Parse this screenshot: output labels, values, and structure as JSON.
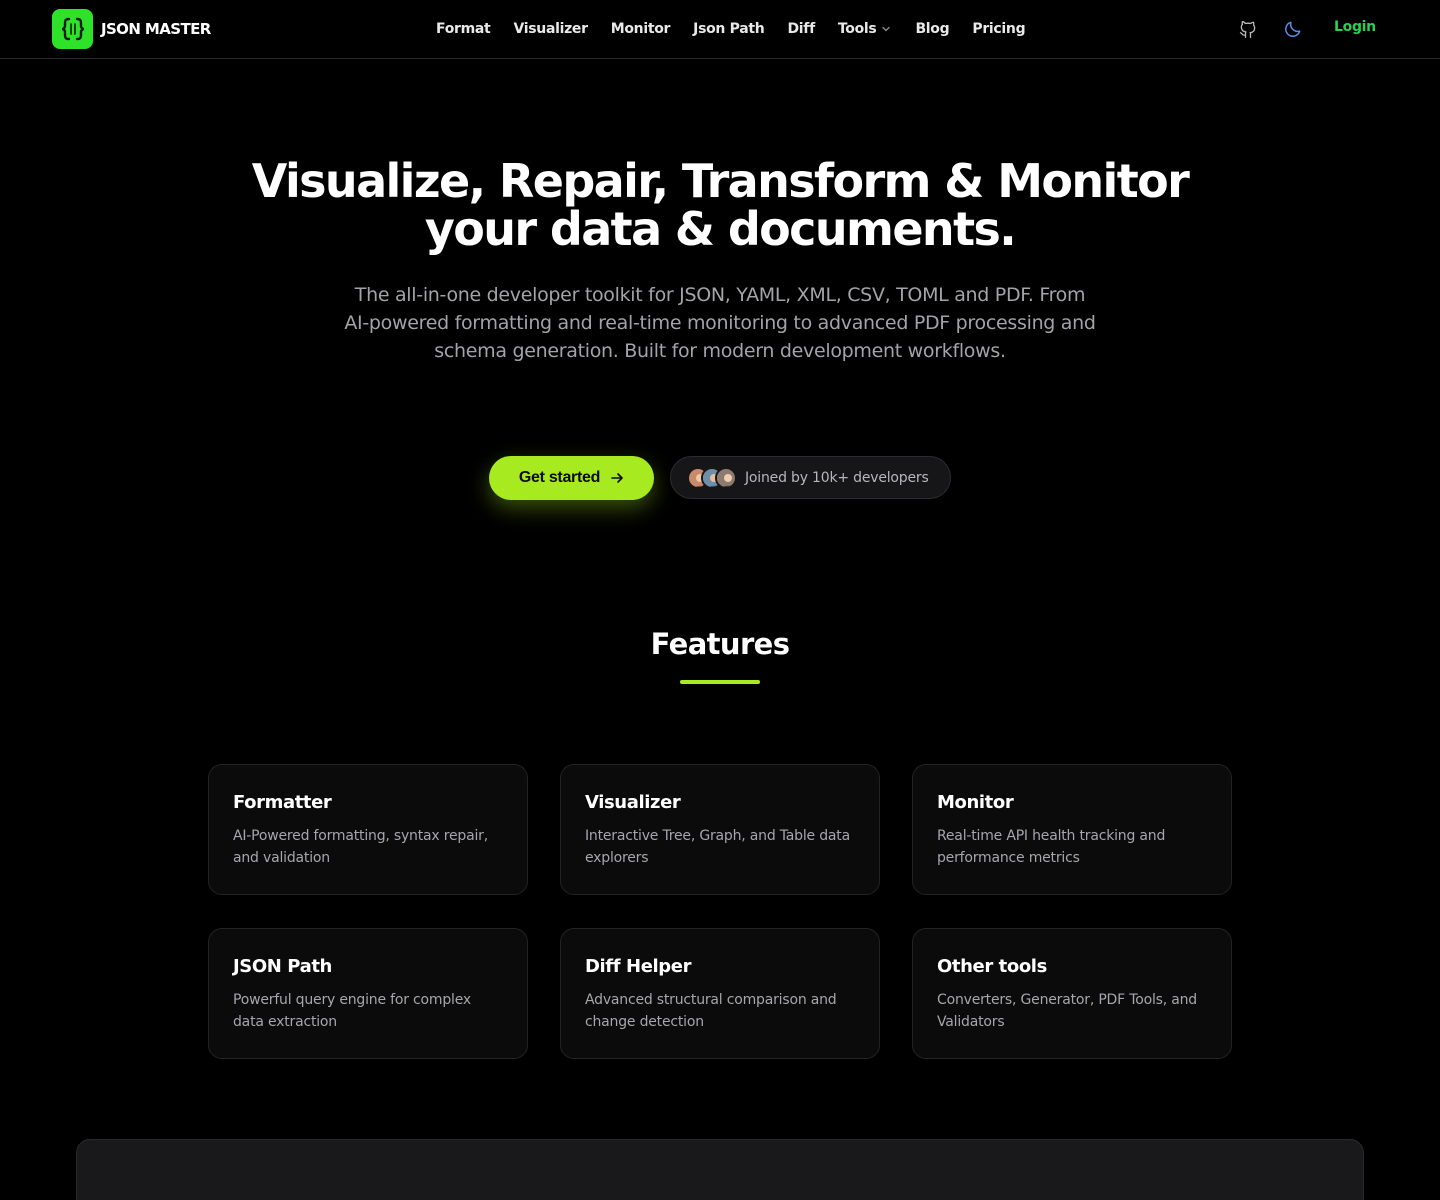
{
  "header": {
    "brand": "JSON MASTER",
    "nav": [
      "Format",
      "Visualizer",
      "Monitor",
      "Json Path",
      "Diff",
      "Tools",
      "Blog",
      "Pricing"
    ],
    "login": "Login"
  },
  "hero": {
    "title_line1": "Visualize, Repair, Transform & Monitor",
    "title_line2": "your data & documents.",
    "subtitle": "The all-in-one developer toolkit for JSON, YAML, XML, CSV, TOML and PDF. From AI-powered formatting and real-time monitoring to advanced PDF processing and schema generation. Built for modern development workflows.",
    "cta": "Get started",
    "joined": "Joined by 10k+ developers"
  },
  "features": {
    "title": "Features",
    "cards": [
      {
        "title": "Formatter",
        "desc": "AI-Powered formatting, syntax repair, and validation"
      },
      {
        "title": "Visualizer",
        "desc": "Interactive Tree, Graph, and Table data explorers"
      },
      {
        "title": "Monitor",
        "desc": "Real-time API health tracking and performance metrics"
      },
      {
        "title": "JSON Path",
        "desc": "Powerful query engine for complex data extraction"
      },
      {
        "title": "Diff Helper",
        "desc": "Advanced structural comparison and change detection"
      },
      {
        "title": "Other tools",
        "desc": "Converters, Generator, PDF Tools, and Validators"
      }
    ]
  },
  "colors": {
    "accent": "#a6ea1f",
    "logo": "#2ee22a",
    "login": "#2bcf52",
    "moon_icon": "#5b8def",
    "background": "#000000"
  },
  "icons": [
    "braces-logo-icon",
    "chevron-down-icon",
    "github-icon",
    "moon-icon",
    "arrow-right-icon"
  ]
}
